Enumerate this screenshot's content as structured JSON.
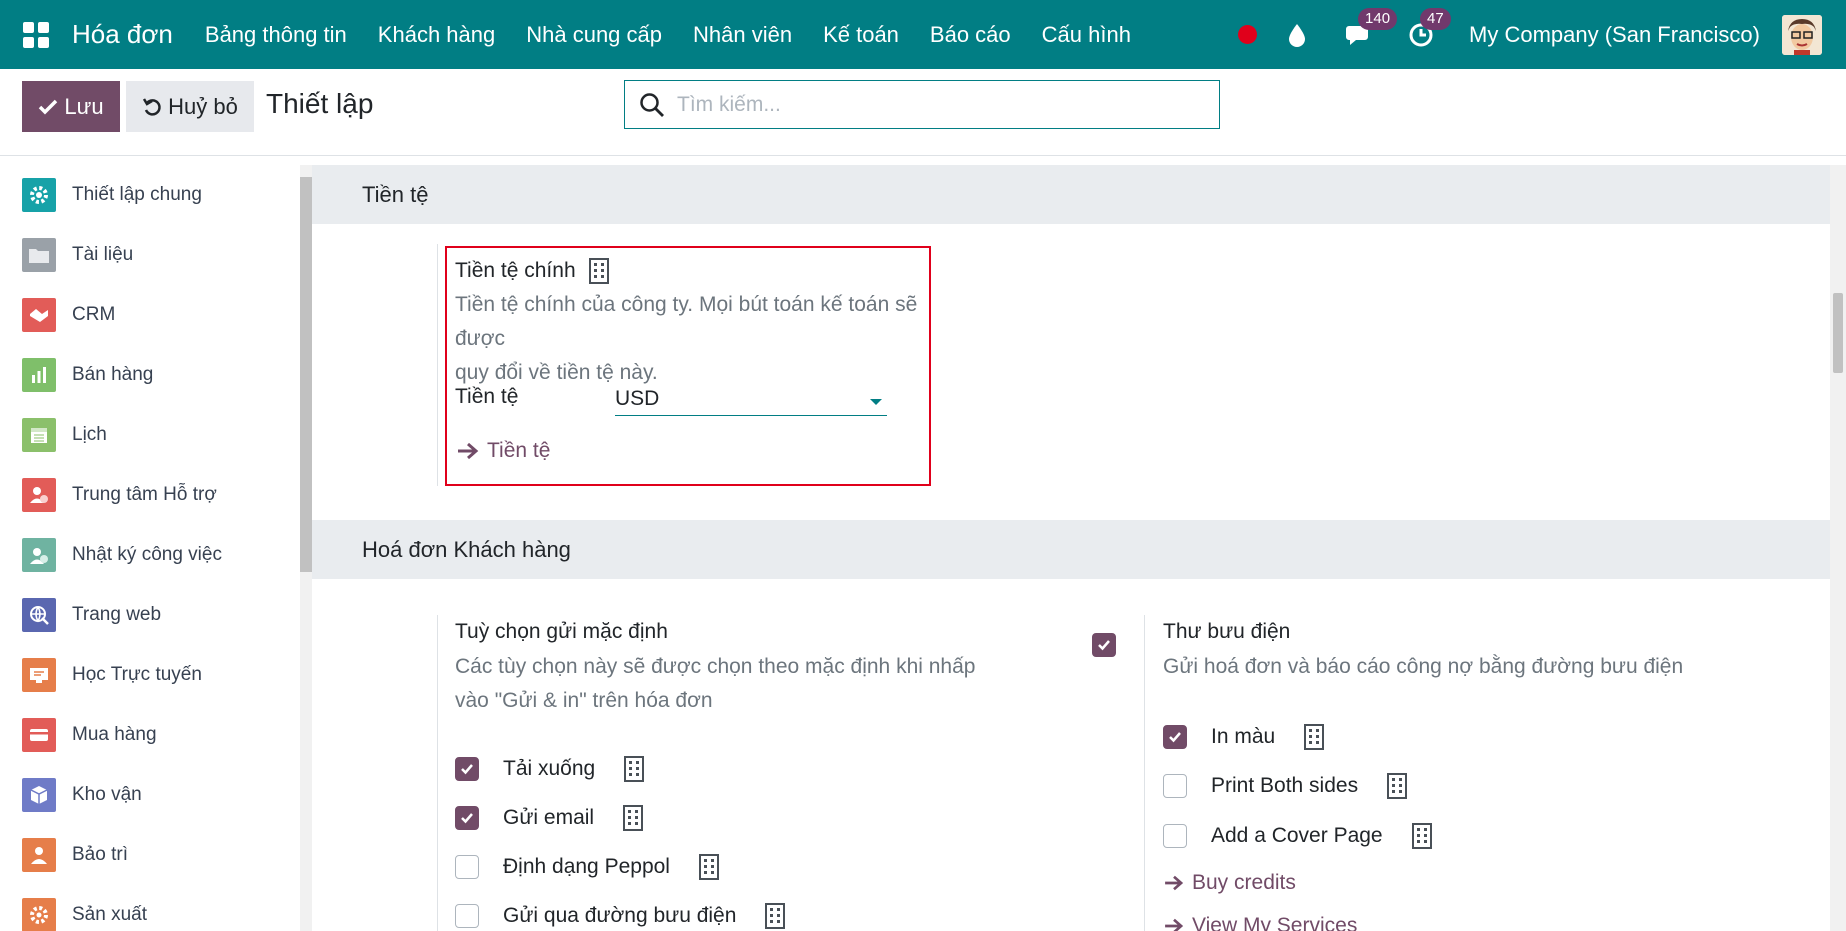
{
  "topbar": {
    "brand": "Hóa đơn",
    "menu": [
      "Bảng thông tin",
      "Khách hàng",
      "Nhà cung cấp",
      "Nhân viên",
      "Kế toán",
      "Báo cáo",
      "Cấu hình"
    ],
    "messages_count": "140",
    "activities_count": "47",
    "company": "My Company (San Francisco)"
  },
  "control": {
    "save_label": "Lưu",
    "cancel_label": "Huỷ bỏ",
    "title": "Thiết lập",
    "search_placeholder": "Tìm kiếm..."
  },
  "sidebar": {
    "items": [
      {
        "label": "Thiết lập chung",
        "color": "#17a2a8"
      },
      {
        "label": "Tài liệu",
        "color": "#9aa1a8"
      },
      {
        "label": "CRM",
        "color": "#e25c58"
      },
      {
        "label": "Bán hàng",
        "color": "#7fbf6a"
      },
      {
        "label": "Lịch",
        "color": "#8bc06b"
      },
      {
        "label": "Trung tâm Hỗ trợ",
        "color": "#e25c58"
      },
      {
        "label": "Nhật ký công việc",
        "color": "#6fb3a1"
      },
      {
        "label": "Trang web",
        "color": "#5a67b0"
      },
      {
        "label": "Học Trực tuyến",
        "color": "#e67e4a"
      },
      {
        "label": "Mua hàng",
        "color": "#e25c58"
      },
      {
        "label": "Kho vận",
        "color": "#6f7bc7"
      },
      {
        "label": "Bảo trì",
        "color": "#e67e4a"
      },
      {
        "label": "Sản xuất",
        "color": "#e67e4a"
      }
    ]
  },
  "currency_section": {
    "header": "Tiền tệ",
    "title": "Tiền tệ chính",
    "description_line1": "Tiền tệ chính của công ty. Mọi bút toán kế toán sẽ được",
    "description_line2": "quy đổi về tiền tệ này.",
    "field_label": "Tiền tệ",
    "field_value": "USD",
    "link": "Tiền tệ",
    "highlight_color": "#e0001b"
  },
  "invoice_section": {
    "header": "Hoá đơn Khách hàng",
    "left": {
      "title": "Tuỳ chọn gửi mặc định",
      "description_line1": "Các tùy chọn này sẽ được chọn theo mặc định khi nhấp",
      "description_line2": "vào \"Gửi & in\" trên hóa đơn",
      "options": [
        {
          "label": "Tải xuống",
          "checked": true
        },
        {
          "label": "Gửi email",
          "checked": true
        },
        {
          "label": "Định dạng Peppol",
          "checked": false
        },
        {
          "label": "Gửi qua đường bưu điện",
          "checked": false
        }
      ]
    },
    "right": {
      "title": "Thư bưu điện",
      "enabled": true,
      "description": "Gửi hoá đơn và báo cáo công nợ bằng đường bưu điện",
      "options": [
        {
          "label": "In màu",
          "checked": true
        },
        {
          "label": "Print Both sides",
          "checked": false
        },
        {
          "label": "Add a Cover Page",
          "checked": false
        }
      ],
      "links": [
        "Buy credits",
        "View My Services"
      ]
    }
  },
  "colors": {
    "navbar": "#017e84",
    "primary": "#714b67",
    "badge": "#71396c"
  }
}
